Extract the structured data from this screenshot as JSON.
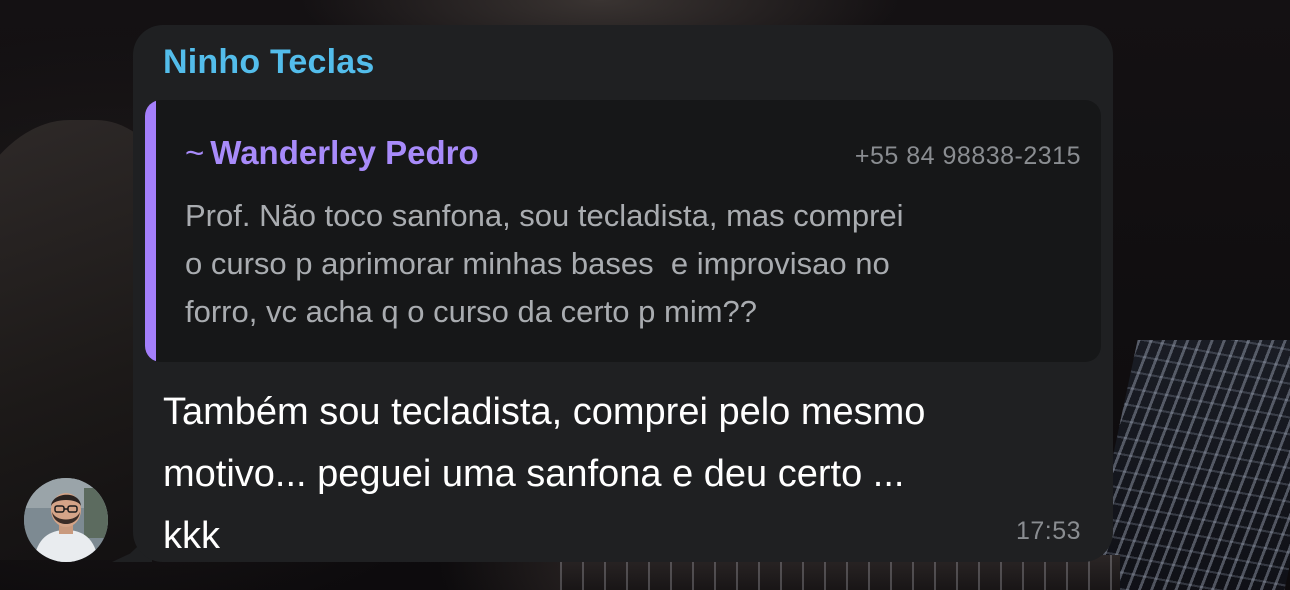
{
  "message": {
    "sender_name": "Ninho Teclas",
    "sender_color": "#53bdeb",
    "quote": {
      "tilde": "~",
      "author": "Wanderley Pedro",
      "author_color": "#a88bfa",
      "phone": "+55 84 98838-2315",
      "text": "Prof. Não toco sanfona, sou tecladista, mas comprei\no curso p aprimorar minhas bases  e improvisao no\nforro, vc acha q o curso da certo p mim??"
    },
    "text": "Também sou tecladista, comprei pelo mesmo\nmotivo... peguei uma sanfona e deu certo ...\nkkk",
    "time": "17:53"
  },
  "avatar": {
    "icon": "user-avatar-photo"
  }
}
